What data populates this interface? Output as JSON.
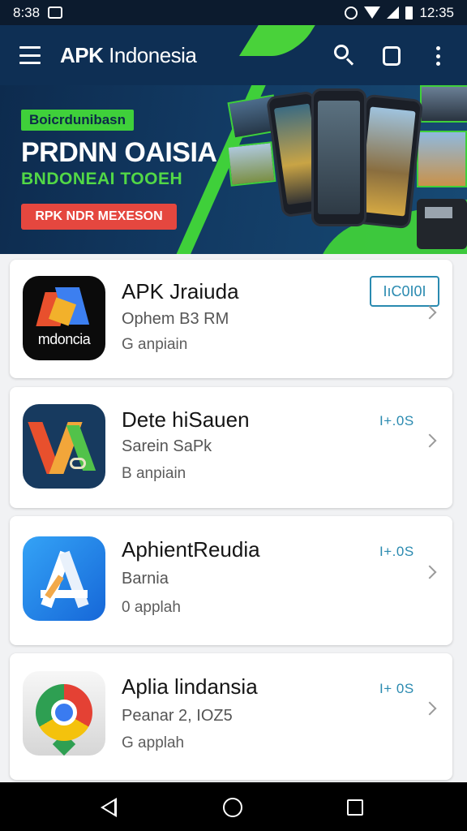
{
  "status_bar": {
    "time": "8:38",
    "clock": "12:35"
  },
  "app_bar": {
    "title_bold": "APK",
    "title_rest": " Indonesia"
  },
  "banner": {
    "tag": "Boicrdunibasn",
    "headline": "PRDNN OAISIA",
    "subline": "BNDONEAI TOOEH",
    "cta": "RPK NDR MEXESON"
  },
  "apps": [
    {
      "name": "APK Jraiuda",
      "subtitle": "Ophem B3 RM",
      "meta": "G anpiain",
      "version": "IıC0I0I",
      "icon": "apk-indonesia-icon",
      "icon_text": "mdoncia"
    },
    {
      "name": "Dete hiSauen",
      "subtitle": "Sarein SaPk",
      "meta": "B anpiain",
      "version": "I+.0S",
      "icon": "colorful-x-app-icon"
    },
    {
      "name": "AphientReudia",
      "subtitle": "Barnia",
      "meta": "0 applah",
      "version": "I+.0S",
      "icon": "app-store-a-icon"
    },
    {
      "name": "Aplia lindansia",
      "subtitle": "Peanar 2, IOZ5",
      "meta": "G applah",
      "version": "I+ 0S",
      "icon": "chrome-maps-icon"
    }
  ]
}
